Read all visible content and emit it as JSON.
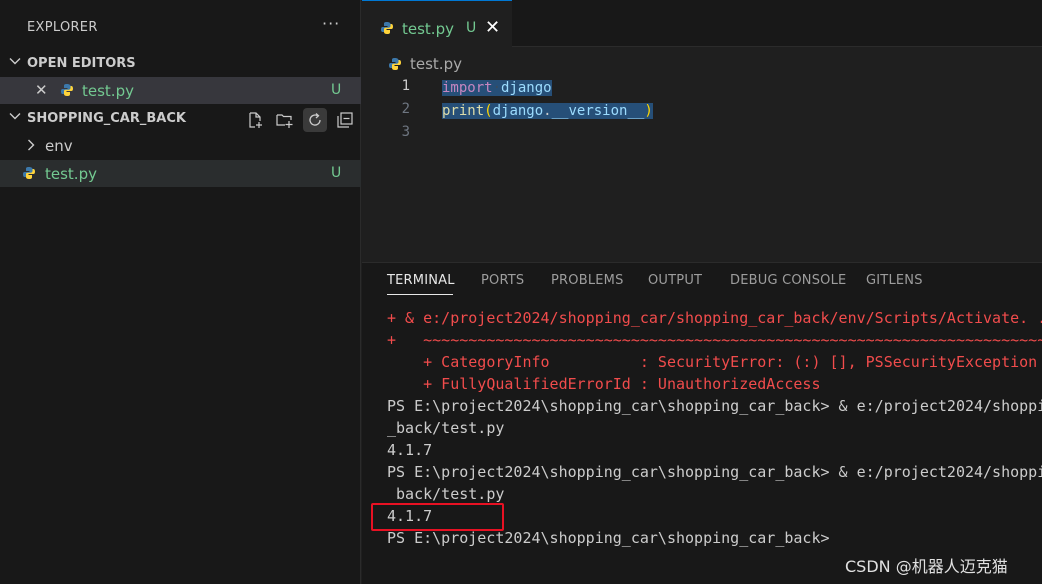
{
  "sidebar": {
    "title": "EXPLORER",
    "more_icon": "ellipsis-icon",
    "open_editors": {
      "label": "OPEN EDITORS",
      "items": [
        {
          "name": "test.py",
          "status": "U"
        }
      ]
    },
    "folder": {
      "label": "SHOPPING_CAR_BACK",
      "actions": [
        "new-file-icon",
        "new-folder-icon",
        "refresh-icon",
        "collapse-all-icon"
      ],
      "items": [
        {
          "type": "folder",
          "name": "env"
        },
        {
          "type": "file",
          "name": "test.py",
          "status": "U"
        }
      ]
    }
  },
  "editor": {
    "tab": {
      "name": "test.py",
      "status": "U"
    },
    "breadcrumb": "test.py",
    "lines": [
      {
        "num": "1",
        "tokens": [
          {
            "t": "import",
            "c": "kw"
          },
          {
            "t": "·",
            "c": "dim"
          },
          {
            "t": "django",
            "c": "id"
          }
        ]
      },
      {
        "num": "2",
        "tokens": [
          {
            "t": "print",
            "c": "fn"
          },
          {
            "t": "(",
            "c": "pn"
          },
          {
            "t": "django",
            "c": "id"
          },
          {
            "t": ".",
            "c": "white"
          },
          {
            "t": "__version__",
            "c": "id"
          },
          {
            "t": ")",
            "c": "pn"
          }
        ]
      },
      {
        "num": "3",
        "tokens": []
      }
    ]
  },
  "panel": {
    "tabs": [
      "TERMINAL",
      "PORTS",
      "PROBLEMS",
      "OUTPUT",
      "DEBUG CONSOLE",
      "GITLENS"
    ],
    "active_tab": "TERMINAL",
    "terminal_lines": [
      {
        "text": "+ & e:/project2024/shopping_car/shopping_car_back/env/Scripts/Activate. ...",
        "color": "red"
      },
      {
        "text": "+   ~~~~~~~~~~~~~~~~~~~~~~~~~~~~~~~~~~~~~~~~~~~~~~~~~~~~~~~~~~~~~~~~~~~~~~~~",
        "color": "red"
      },
      {
        "text": "    + CategoryInfo          : SecurityError: (:) [], PSSecurityException",
        "color": "red"
      },
      {
        "text": "    + FullyQualifiedErrorId : UnauthorizedAccess",
        "color": "red"
      },
      {
        "text": "PS E:\\project2024\\shopping_car\\shopping_car_back> & e:/project2024/shoppi",
        "color": "white"
      },
      {
        "text": "_back/test.py",
        "color": "white"
      },
      {
        "text": "4.1.7",
        "color": "white"
      },
      {
        "text": "PS E:\\project2024\\shopping_car\\shopping_car_back> & e:/project2024/shoppi",
        "color": "white"
      },
      {
        "text": " back/test.py",
        "color": "white"
      },
      {
        "text": "4.1.7",
        "color": "white"
      },
      {
        "text": "PS E:\\project2024\\shopping_car\\shopping_car_back>",
        "color": "white"
      }
    ]
  },
  "watermark": "CSDN @机器人迈克猫",
  "colors": {
    "accent": "#0078d4",
    "untracked": "#73c991",
    "error": "#f14c4c",
    "highlight_box": "#e81123"
  }
}
